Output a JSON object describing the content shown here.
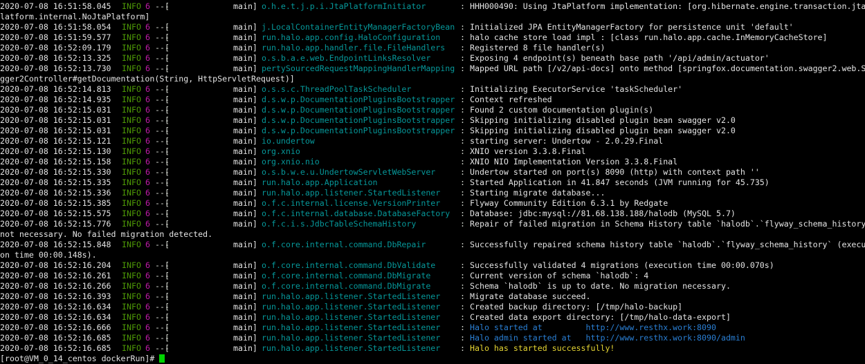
{
  "terminal": {
    "prompt": "[root@VM_0_14_centos dockerRun]#",
    "lines": [
      {
        "type": "log",
        "ts": "2020-07-08 16:51:58.045",
        "level": "INFO",
        "pid": "6",
        "sep": "---",
        "bracket": "[",
        "thread": "main]",
        "logger": "o.h.e.t.j.p.i.JtaPlatformInitiator",
        "colon": ":",
        "message": "HHH000490: Using JtaPlatform implementation: [org.hibernate.engine.transaction.jta.",
        "msgclass": ""
      },
      {
        "type": "cont",
        "text": "latform.internal.NoJtaPlatform]"
      },
      {
        "type": "log",
        "ts": "2020-07-08 16:51:58.054",
        "level": "INFO",
        "pid": "6",
        "sep": "---",
        "bracket": "[",
        "thread": "main]",
        "logger": "j.LocalContainerEntityManagerFactoryBean",
        "colon": ":",
        "message": "Initialized JPA EntityManagerFactory for persistence unit 'default'",
        "msgclass": ""
      },
      {
        "type": "log",
        "ts": "2020-07-08 16:51:59.577",
        "level": "INFO",
        "pid": "6",
        "sep": "---",
        "bracket": "[",
        "thread": "main]",
        "logger": "run.halo.app.config.HaloConfiguration",
        "colon": ":",
        "message": "halo cache store load impl : [class run.halo.app.cache.InMemoryCacheStore]",
        "msgclass": ""
      },
      {
        "type": "log",
        "ts": "2020-07-08 16:52:09.179",
        "level": "INFO",
        "pid": "6",
        "sep": "---",
        "bracket": "[",
        "thread": "main]",
        "logger": "run.halo.app.handler.file.FileHandlers",
        "colon": ":",
        "message": "Registered 8 file handler(s)",
        "msgclass": ""
      },
      {
        "type": "log",
        "ts": "2020-07-08 16:52:13.325",
        "level": "INFO",
        "pid": "6",
        "sep": "---",
        "bracket": "[",
        "thread": "main]",
        "logger": "o.s.b.a.e.web.EndpointLinksResolver",
        "colon": ":",
        "message": "Exposing 4 endpoint(s) beneath base path '/api/admin/actuator'",
        "msgclass": ""
      },
      {
        "type": "log",
        "ts": "2020-07-08 16:52:13.730",
        "level": "INFO",
        "pid": "6",
        "sep": "---",
        "bracket": "[",
        "thread": "main]",
        "logger": "pertySourcedRequestMappingHandlerMapping",
        "colon": ":",
        "message": "Mapped URL path [/v2/api-docs] onto method [springfox.documentation.swagger2.web.S",
        "msgclass": ""
      },
      {
        "type": "cont",
        "text": "gger2Controller#getDocumentation(String, HttpServletRequest)]"
      },
      {
        "type": "log",
        "ts": "2020-07-08 16:52:14.813",
        "level": "INFO",
        "pid": "6",
        "sep": "---",
        "bracket": "[",
        "thread": "main]",
        "logger": "o.s.s.c.ThreadPoolTaskScheduler",
        "colon": ":",
        "message": "Initializing ExecutorService 'taskScheduler'",
        "msgclass": ""
      },
      {
        "type": "log",
        "ts": "2020-07-08 16:52:14.935",
        "level": "INFO",
        "pid": "6",
        "sep": "---",
        "bracket": "[",
        "thread": "main]",
        "logger": "d.s.w.p.DocumentationPluginsBootstrapper",
        "colon": ":",
        "message": "Context refreshed",
        "msgclass": ""
      },
      {
        "type": "log",
        "ts": "2020-07-08 16:52:15.031",
        "level": "INFO",
        "pid": "6",
        "sep": "---",
        "bracket": "[",
        "thread": "main]",
        "logger": "d.s.w.p.DocumentationPluginsBootstrapper",
        "colon": ":",
        "message": "Found 2 custom documentation plugin(s)",
        "msgclass": ""
      },
      {
        "type": "log",
        "ts": "2020-07-08 16:52:15.031",
        "level": "INFO",
        "pid": "6",
        "sep": "---",
        "bracket": "[",
        "thread": "main]",
        "logger": "d.s.w.p.DocumentationPluginsBootstrapper",
        "colon": ":",
        "message": "Skipping initializing disabled plugin bean swagger v2.0",
        "msgclass": ""
      },
      {
        "type": "log",
        "ts": "2020-07-08 16:52:15.031",
        "level": "INFO",
        "pid": "6",
        "sep": "---",
        "bracket": "[",
        "thread": "main]",
        "logger": "d.s.w.p.DocumentationPluginsBootstrapper",
        "colon": ":",
        "message": "Skipping initializing disabled plugin bean swagger v2.0",
        "msgclass": ""
      },
      {
        "type": "log",
        "ts": "2020-07-08 16:52:15.121",
        "level": "INFO",
        "pid": "6",
        "sep": "---",
        "bracket": "[",
        "thread": "main]",
        "logger": "io.undertow",
        "colon": ":",
        "message": "starting server: Undertow - 2.0.29.Final",
        "msgclass": ""
      },
      {
        "type": "log",
        "ts": "2020-07-08 16:52:15.130",
        "level": "INFO",
        "pid": "6",
        "sep": "---",
        "bracket": "[",
        "thread": "main]",
        "logger": "org.xnio",
        "colon": ":",
        "message": "XNIO version 3.3.8.Final",
        "msgclass": ""
      },
      {
        "type": "log",
        "ts": "2020-07-08 16:52:15.158",
        "level": "INFO",
        "pid": "6",
        "sep": "---",
        "bracket": "[",
        "thread": "main]",
        "logger": "org.xnio.nio",
        "colon": ":",
        "message": "XNIO NIO Implementation Version 3.3.8.Final",
        "msgclass": ""
      },
      {
        "type": "log",
        "ts": "2020-07-08 16:52:15.330",
        "level": "INFO",
        "pid": "6",
        "sep": "---",
        "bracket": "[",
        "thread": "main]",
        "logger": "o.s.b.w.e.u.UndertowServletWebServer",
        "colon": ":",
        "message": "Undertow started on port(s) 8090 (http) with context path ''",
        "msgclass": ""
      },
      {
        "type": "log",
        "ts": "2020-07-08 16:52:15.335",
        "level": "INFO",
        "pid": "6",
        "sep": "---",
        "bracket": "[",
        "thread": "main]",
        "logger": "run.halo.app.Application",
        "colon": ":",
        "message": "Started Application in 41.847 seconds (JVM running for 45.735)",
        "msgclass": ""
      },
      {
        "type": "log",
        "ts": "2020-07-08 16:52:15.336",
        "level": "INFO",
        "pid": "6",
        "sep": "---",
        "bracket": "[",
        "thread": "main]",
        "logger": "run.halo.app.listener.StartedListener",
        "colon": ":",
        "message": "Starting migrate database...",
        "msgclass": ""
      },
      {
        "type": "log",
        "ts": "2020-07-08 16:52:15.385",
        "level": "INFO",
        "pid": "6",
        "sep": "---",
        "bracket": "[",
        "thread": "main]",
        "logger": "o.f.c.internal.license.VersionPrinter",
        "colon": ":",
        "message": "Flyway Community Edition 6.3.1 by Redgate",
        "msgclass": ""
      },
      {
        "type": "log",
        "ts": "2020-07-08 16:52:15.575",
        "level": "INFO",
        "pid": "6",
        "sep": "---",
        "bracket": "[",
        "thread": "main]",
        "logger": "o.f.c.internal.database.DatabaseFactory",
        "colon": ":",
        "message": "Database: jdbc:mysql://81.68.138.188/halodb (MySQL 5.7)",
        "msgclass": ""
      },
      {
        "type": "log",
        "ts": "2020-07-08 16:52:15.776",
        "level": "INFO",
        "pid": "6",
        "sep": "---",
        "bracket": "[",
        "thread": "main]",
        "logger": "o.f.c.i.s.JdbcTableSchemaHistory",
        "colon": ":",
        "message": "Repair of failed migration in Schema History table `halodb`.`flyway_schema_history",
        "msgclass": ""
      },
      {
        "type": "cont",
        "text": "not necessary. No failed migration detected."
      },
      {
        "type": "log",
        "ts": "2020-07-08 16:52:15.848",
        "level": "INFO",
        "pid": "6",
        "sep": "---",
        "bracket": "[",
        "thread": "main]",
        "logger": "o.f.core.internal.command.DbRepair",
        "colon": ":",
        "message": "Successfully repaired schema history table `halodb`.`flyway_schema_history` (execu",
        "msgclass": ""
      },
      {
        "type": "cont",
        "text": "on time 00:00.148s)."
      },
      {
        "type": "log",
        "ts": "2020-07-08 16:52:16.204",
        "level": "INFO",
        "pid": "6",
        "sep": "---",
        "bracket": "[",
        "thread": "main]",
        "logger": "o.f.core.internal.command.DbValidate",
        "colon": ":",
        "message": "Successfully validated 4 migrations (execution time 00:00.070s)",
        "msgclass": ""
      },
      {
        "type": "log",
        "ts": "2020-07-08 16:52:16.261",
        "level": "INFO",
        "pid": "6",
        "sep": "---",
        "bracket": "[",
        "thread": "main]",
        "logger": "o.f.core.internal.command.DbMigrate",
        "colon": ":",
        "message": "Current version of schema `halodb`: 4",
        "msgclass": ""
      },
      {
        "type": "log",
        "ts": "2020-07-08 16:52:16.266",
        "level": "INFO",
        "pid": "6",
        "sep": "---",
        "bracket": "[",
        "thread": "main]",
        "logger": "o.f.core.internal.command.DbMigrate",
        "colon": ":",
        "message": "Schema `halodb` is up to date. No migration necessary.",
        "msgclass": ""
      },
      {
        "type": "log",
        "ts": "2020-07-08 16:52:16.393",
        "level": "INFO",
        "pid": "6",
        "sep": "---",
        "bracket": "[",
        "thread": "main]",
        "logger": "run.halo.app.listener.StartedListener",
        "colon": ":",
        "message": "Migrate database succeed.",
        "msgclass": ""
      },
      {
        "type": "log",
        "ts": "2020-07-08 16:52:16.634",
        "level": "INFO",
        "pid": "6",
        "sep": "---",
        "bracket": "[",
        "thread": "main]",
        "logger": "run.halo.app.listener.StartedListener",
        "colon": ":",
        "message": "Created backup directory: [/tmp/halo-backup]",
        "msgclass": ""
      },
      {
        "type": "log",
        "ts": "2020-07-08 16:52:16.634",
        "level": "INFO",
        "pid": "6",
        "sep": "---",
        "bracket": "[",
        "thread": "main]",
        "logger": "run.halo.app.listener.StartedListener",
        "colon": ":",
        "message": "Created data export directory: [/tmp/halo-data-export]",
        "msgclass": ""
      },
      {
        "type": "log",
        "ts": "2020-07-08 16:52:16.666",
        "level": "INFO",
        "pid": "6",
        "sep": "---",
        "bracket": "[",
        "thread": "main]",
        "logger": "run.halo.app.listener.StartedListener",
        "colon": ":",
        "message": "Halo started at         http://www.resthx.work:8090",
        "msgclass": "blue"
      },
      {
        "type": "log",
        "ts": "2020-07-08 16:52:16.685",
        "level": "INFO",
        "pid": "6",
        "sep": "---",
        "bracket": "[",
        "thread": "main]",
        "logger": "run.halo.app.listener.StartedListener",
        "colon": ":",
        "message": "Halo admin started at   http://www.resthx.work:8090/admin",
        "msgclass": "blue"
      },
      {
        "type": "log",
        "ts": "2020-07-08 16:52:16.685",
        "level": "INFO",
        "pid": "6",
        "sep": "---",
        "bracket": "[",
        "thread": "main]",
        "logger": "run.halo.app.listener.StartedListener",
        "colon": ":",
        "message": "Halo has started successfully!",
        "msgclass": "yellow"
      }
    ]
  }
}
